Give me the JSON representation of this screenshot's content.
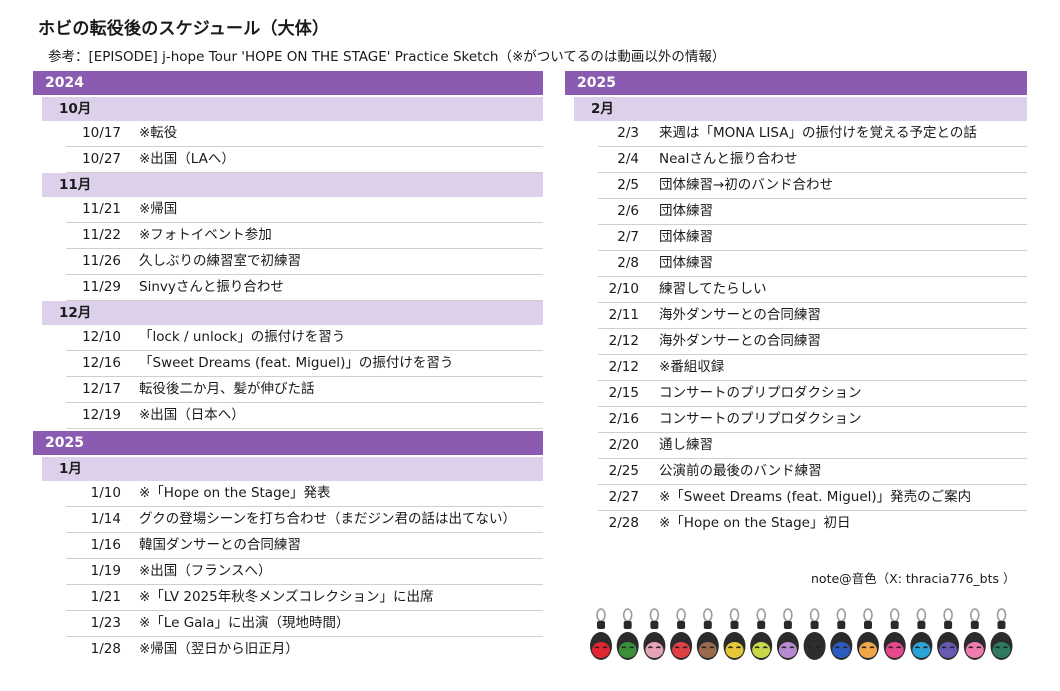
{
  "header": {
    "title": "ホビの転役後のスケジュール（大体）",
    "reference": "参考：[EPISODE] j-hope Tour 'HOPE ON THE STAGE' Practice Sketch（※がついてるのは動画以外の情報）"
  },
  "left": {
    "y2024": "2024",
    "oct": {
      "label": "10月",
      "rows": [
        {
          "date": "10/17",
          "event": "※転役"
        },
        {
          "date": "10/27",
          "event": "※出国（LAへ）"
        }
      ]
    },
    "nov": {
      "label": "11月",
      "rows": [
        {
          "date": "11/21",
          "event": "※帰国"
        },
        {
          "date": "11/22",
          "event": "※フォトイベント参加"
        },
        {
          "date": "11/26",
          "event": "久しぶりの練習室で初練習"
        },
        {
          "date": "11/29",
          "event": "Sinvyさんと振り合わせ"
        }
      ]
    },
    "dec": {
      "label": "12月",
      "rows": [
        {
          "date": "12/10",
          "event": "「lock / unlock」の振付けを習う"
        },
        {
          "date": "12/16",
          "event": "「Sweet Dreams (feat. Miguel)」の振付けを習う"
        },
        {
          "date": "12/17",
          "event": "転役後二か月、髪が伸びた話"
        },
        {
          "date": "12/19",
          "event": "※出国（日本へ）"
        }
      ]
    },
    "y2025": "2025",
    "jan": {
      "label": "1月",
      "rows": [
        {
          "date": "1/10",
          "event": "※「Hope on the Stage」発表"
        },
        {
          "date": "1/14",
          "event": "グクの登場シーンを打ち合わせ（まだジン君の話は出てない）"
        },
        {
          "date": "1/16",
          "event": "韓国ダンサーとの合同練習"
        },
        {
          "date": "1/19",
          "event": "※出国（フランスへ）"
        },
        {
          "date": "1/21",
          "event": "※「LV 2025年秋冬メンズコレクション」に出席"
        },
        {
          "date": "1/23",
          "event": "※「Le Gala」に出演（現地時間）"
        },
        {
          "date": "1/28",
          "event": "※帰国（翌日から旧正月）"
        }
      ]
    }
  },
  "right": {
    "y2025": "2025",
    "feb": {
      "label": "2月",
      "rows": [
        {
          "date": "2/3",
          "event": "来週は「MONA LISA」の振付けを覚える予定との話"
        },
        {
          "date": "2/4",
          "event": "Nealさんと振り合わせ"
        },
        {
          "date": "2/5",
          "event": "団体練習→初のバンド合わせ"
        },
        {
          "date": "2/6",
          "event": "団体練習"
        },
        {
          "date": "2/7",
          "event": "団体練習"
        },
        {
          "date": "2/8",
          "event": "団体練習"
        },
        {
          "date": "2/10",
          "event": "練習してたらしい"
        },
        {
          "date": "2/11",
          "event": "海外ダンサーとの合同練習"
        },
        {
          "date": "2/12",
          "event": "海外ダンサーとの合同練習"
        },
        {
          "date": "2/12",
          "event": "※番組収録"
        },
        {
          "date": "2/15",
          "event": "コンサートのプリプロダクション"
        },
        {
          "date": "2/16",
          "event": "コンサートのプリプロダクション"
        },
        {
          "date": "2/20",
          "event": "通し練習"
        },
        {
          "date": "2/25",
          "event": "公演前の最後のバンド練習"
        },
        {
          "date": "2/27",
          "event": "※「Sweet Dreams (feat. Miguel)」発売のご案内"
        },
        {
          "date": "2/28",
          "event": "※「Hope on the Stage」初日"
        }
      ]
    }
  },
  "footer": {
    "credit": "note@音色（X: thracia776_bts ）"
  },
  "charm_colors": [
    "#e02632",
    "#3c8f3a",
    "#e4a4b6",
    "#df3f45",
    "#9a6a4c",
    "#e8c63a",
    "#c8d84a",
    "#b88ad0",
    "#2d2d2d",
    "#2c5bbf",
    "#f0a64a",
    "#e6488e",
    "#2ca3d7",
    "#6a58b5",
    "#ee7cb0",
    "#2f7a5e"
  ]
}
